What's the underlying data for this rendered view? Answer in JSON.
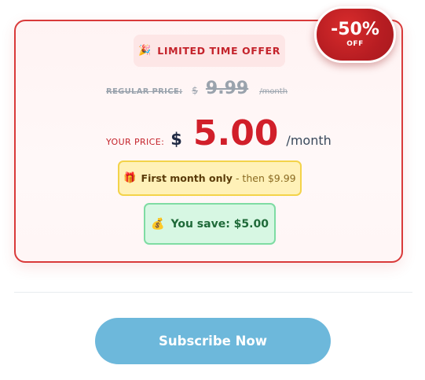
{
  "badge": {
    "discount": "-50%",
    "off_label": "OFF"
  },
  "offer": {
    "party_icon": "party-popper-icon",
    "limited_label": "LIMITED TIME OFFER"
  },
  "regular_price": {
    "label": "REGULAR PRICE:",
    "currency": "$",
    "amount": "9.99",
    "period": "/month"
  },
  "your_price": {
    "label": "YOUR PRICE:",
    "currency": "$",
    "amount": "5.00",
    "period": "/month"
  },
  "first_month": {
    "icon": "gift-icon",
    "strong": "First month only",
    "rest": "- then $9.99"
  },
  "savings": {
    "icon": "money-bag-icon",
    "text": "You save: $5.00"
  },
  "cta": {
    "subscribe_label": "Subscribe Now"
  },
  "colors": {
    "accent_red": "#d11f2a",
    "button_blue": "#6db8db",
    "savings_green": "#1f6a39"
  }
}
